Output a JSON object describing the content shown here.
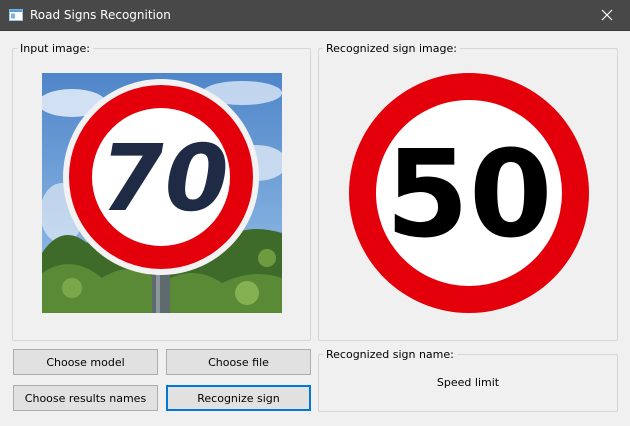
{
  "window": {
    "title": "Road Signs Recognition"
  },
  "input_panel": {
    "label": "Input image:",
    "sign_number": "70"
  },
  "recognized_panel": {
    "label": "Recognized sign image:",
    "sign_number": "50"
  },
  "buttons": {
    "choose_model": "Choose model",
    "choose_file": "Choose file",
    "choose_results_names": "Choose results names",
    "recognize_sign": "Recognize sign"
  },
  "name_panel": {
    "label": "Recognized sign name:",
    "value": "Speed limit"
  },
  "colors": {
    "titlebar": "#484848",
    "accent": "#0078d7",
    "sign_red": "#e3000b"
  }
}
